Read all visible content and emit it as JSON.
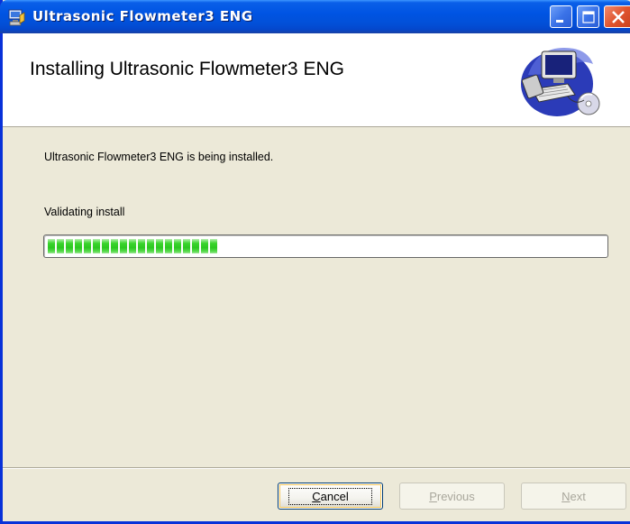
{
  "window": {
    "title": "Ultrasonic Flowmeter3 ENG",
    "title_icon": "installer-icon",
    "controls": [
      "minimize",
      "maximize",
      "close"
    ]
  },
  "header": {
    "title": "Installing Ultrasonic Flowmeter3 ENG",
    "art_icon": "computer-with-cd-icon"
  },
  "body": {
    "status": "Ultrasonic Flowmeter3 ENG is being installed.",
    "action": "Validating install",
    "progress": {
      "blocks_filled": 19,
      "percent": 35
    }
  },
  "buttons": {
    "cancel": {
      "mnemonic": "C",
      "rest": "ancel",
      "enabled": true
    },
    "previous": {
      "mnemonic": "P",
      "rest": "revious",
      "enabled": false
    },
    "next": {
      "mnemonic": "N",
      "rest": "ext",
      "enabled": false
    }
  },
  "colors": {
    "titlebar": "#0054e3",
    "dialog_bg": "#ece9d8",
    "progress_green": "#2bc820",
    "disabled_text": "#a9a79c"
  }
}
